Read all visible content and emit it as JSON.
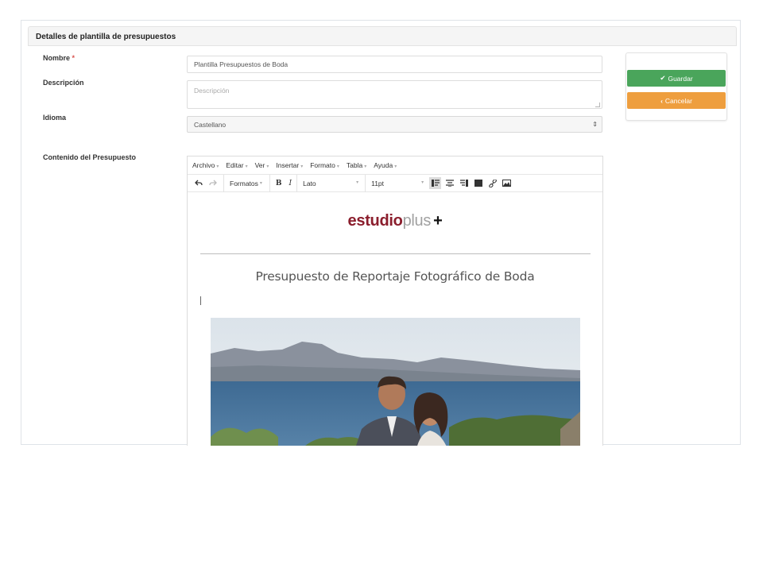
{
  "panel": {
    "title": "Detalles de plantilla de presupuestos"
  },
  "form": {
    "nombre": {
      "label": "Nombre",
      "required_mark": "*",
      "value": "Plantilla Presupuestos de Boda"
    },
    "descripcion": {
      "label": "Descripción",
      "placeholder": "Descripción"
    },
    "idioma": {
      "label": "Idioma",
      "value": "Castellano"
    },
    "contenido": {
      "label": "Contenido del Presupuesto"
    }
  },
  "editor": {
    "menubar": [
      {
        "label": "Archivo"
      },
      {
        "label": "Editar"
      },
      {
        "label": "Ver"
      },
      {
        "label": "Insertar"
      },
      {
        "label": "Formato"
      },
      {
        "label": "Tabla"
      },
      {
        "label": "Ayuda"
      }
    ],
    "toolbar": {
      "formats_label": "Formatos",
      "font_family": "Lato",
      "font_size": "11pt",
      "bold": "B",
      "italic": "I"
    },
    "document": {
      "logo_part1": "estudio",
      "logo_part2": "plus",
      "logo_part3": "+",
      "title": "Presupuesto de Reportaje Fotográfico de Boda"
    }
  },
  "actions": {
    "save_label": "Guardar",
    "cancel_label": "Cancelar"
  },
  "colors": {
    "save": "#4aa55b",
    "cancel": "#ee9e3e",
    "logo_accent": "#8b1e2d"
  }
}
